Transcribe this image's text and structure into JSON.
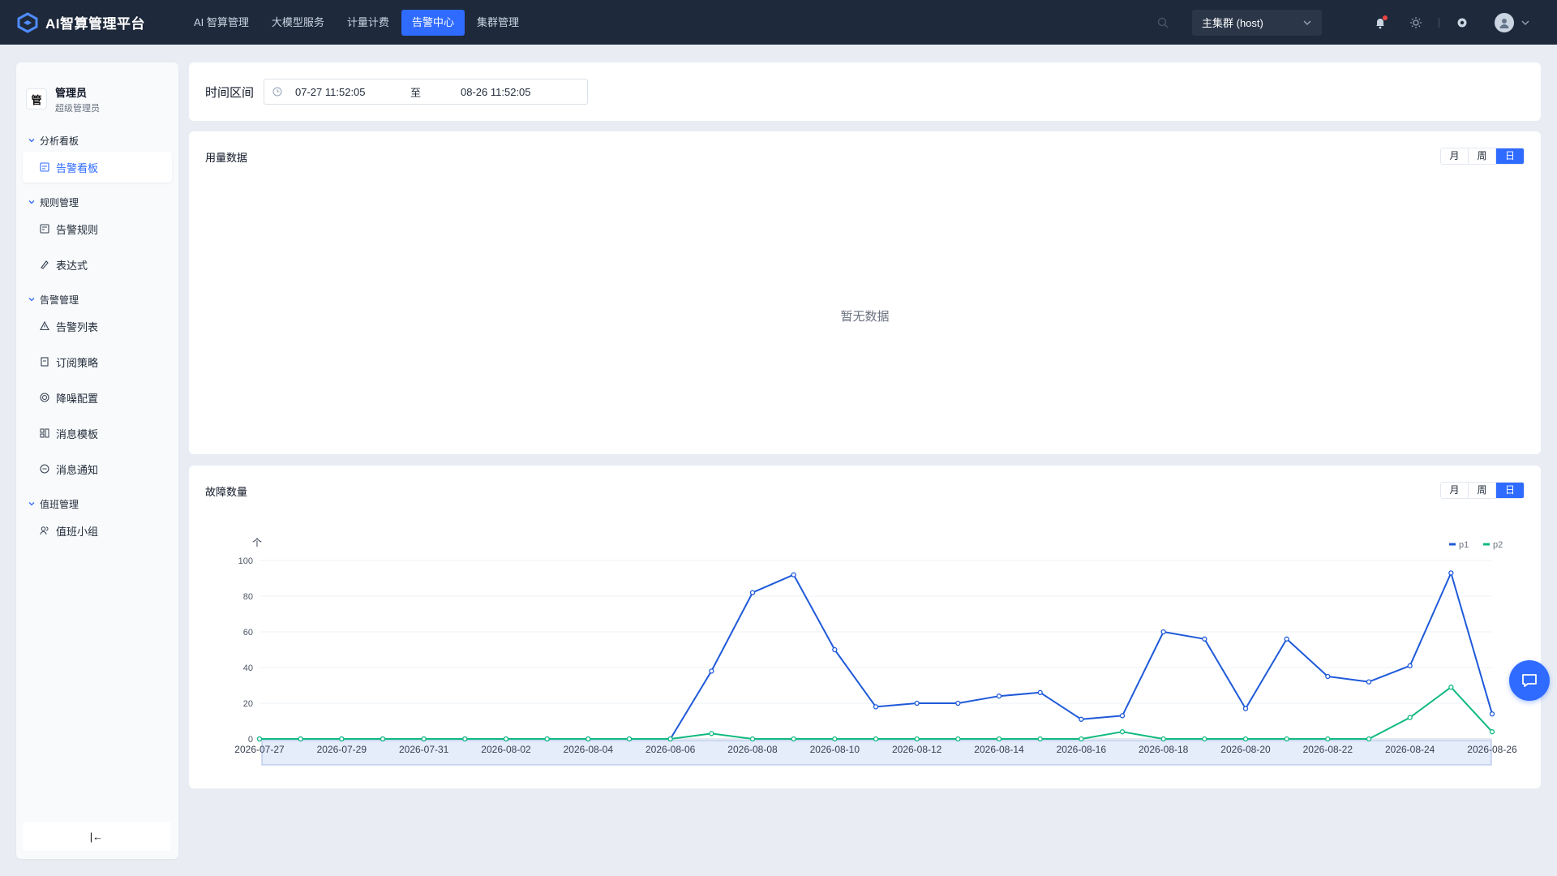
{
  "app": {
    "title": "AI智算管理平台"
  },
  "nav": {
    "items": [
      {
        "label": "AI 智算管理",
        "active": false
      },
      {
        "label": "大模型服务",
        "active": false
      },
      {
        "label": "计量计费",
        "active": false
      },
      {
        "label": "告警中心",
        "active": true
      },
      {
        "label": "集群管理",
        "active": false
      }
    ]
  },
  "topbar": {
    "cluster": "主集群 (host)"
  },
  "user": {
    "avatar_char": "管",
    "name": "管理员",
    "role": "超级管理员"
  },
  "sidebar": {
    "groups": [
      {
        "title": "分析看板",
        "items": [
          {
            "label": "告警看板",
            "icon": "dashboard-icon",
            "active": true
          }
        ]
      },
      {
        "title": "规则管理",
        "items": [
          {
            "label": "告警规则",
            "icon": "rule-icon"
          },
          {
            "label": "表达式",
            "icon": "expression-icon"
          }
        ]
      },
      {
        "title": "告警管理",
        "items": [
          {
            "label": "告警列表",
            "icon": "warning-icon"
          },
          {
            "label": "订阅策略",
            "icon": "subscribe-icon"
          },
          {
            "label": "降噪配置",
            "icon": "noise-icon"
          },
          {
            "label": "消息模板",
            "icon": "template-icon"
          },
          {
            "label": "消息通知",
            "icon": "notify-icon"
          }
        ]
      },
      {
        "title": "值班管理",
        "items": [
          {
            "label": "值班小组",
            "icon": "team-icon"
          }
        ]
      }
    ],
    "collapse_glyph": "|←"
  },
  "time_range": {
    "label": "时间区间",
    "start": "07-27 11:52:05",
    "separator": "至",
    "end": "08-26 11:52:05"
  },
  "usage": {
    "title": "用量数据",
    "empty": "暂无数据",
    "segments": [
      "月",
      "周",
      "日"
    ],
    "active_segment": "日"
  },
  "fault": {
    "title": "故障数量",
    "segments": [
      "月",
      "周",
      "日"
    ],
    "active_segment": "日"
  },
  "colors": {
    "primary": "#2f6bff",
    "p1": "#1f5ad9",
    "p2": "#10b981",
    "topbar": "#1e293b"
  },
  "chart_data": {
    "type": "line",
    "title": "",
    "ylabel": "个",
    "xlabel": "",
    "ylim": [
      0,
      100
    ],
    "yticks": [
      0,
      20,
      40,
      60,
      80,
      100
    ],
    "legend_position": "top-right",
    "grid": true,
    "x": [
      "2026-07-27",
      "2026-07-28",
      "2026-07-29",
      "2026-07-30",
      "2026-07-31",
      "2026-08-01",
      "2026-08-02",
      "2026-08-03",
      "2026-08-04",
      "2026-08-05",
      "2026-08-06",
      "2026-08-07",
      "2026-08-08",
      "2026-08-09",
      "2026-08-10",
      "2026-08-11",
      "2026-08-12",
      "2026-08-13",
      "2026-08-14",
      "2026-08-15",
      "2026-08-16",
      "2026-08-17",
      "2026-08-18",
      "2026-08-19",
      "2026-08-20",
      "2026-08-21",
      "2026-08-22",
      "2026-08-23",
      "2026-08-24",
      "2026-08-25",
      "2026-08-26"
    ],
    "xtick_labels": [
      "2026-07-27",
      "2026-07-29",
      "2026-07-31",
      "2026-08-02",
      "2026-08-04",
      "2026-08-06",
      "2026-08-08",
      "2026-08-10",
      "2026-08-12",
      "2026-08-14",
      "2026-08-16",
      "2026-08-18",
      "2026-08-20",
      "2026-08-22",
      "2026-08-24",
      "2026-08-26"
    ],
    "series": [
      {
        "name": "p1",
        "values": [
          0,
          0,
          0,
          0,
          0,
          0,
          0,
          0,
          0,
          0,
          0,
          38,
          82,
          92,
          50,
          18,
          20,
          20,
          24,
          26,
          11,
          13,
          60,
          56,
          17,
          56,
          35,
          32,
          41,
          93,
          14
        ]
      },
      {
        "name": "p2",
        "values": [
          0,
          0,
          0,
          0,
          0,
          0,
          0,
          0,
          0,
          0,
          0,
          3,
          0,
          0,
          0,
          0,
          0,
          0,
          0,
          0,
          0,
          4,
          0,
          0,
          0,
          0,
          0,
          0,
          12,
          29,
          4
        ]
      }
    ]
  }
}
